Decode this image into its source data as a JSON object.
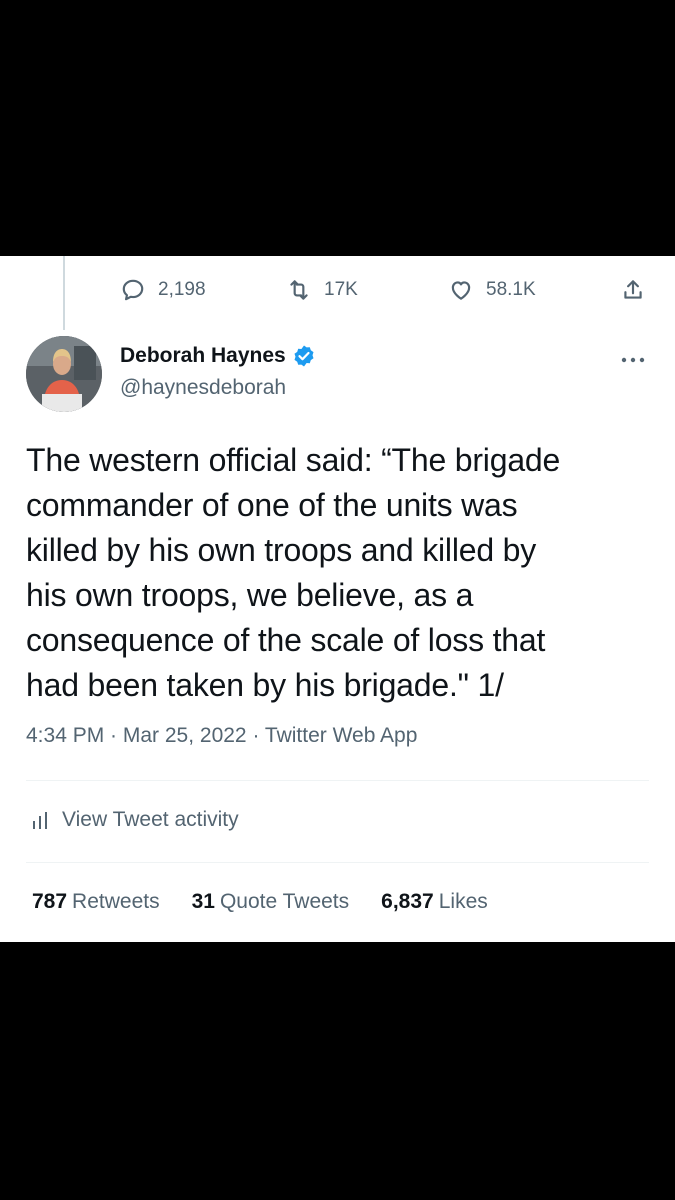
{
  "actions": {
    "reply_count": "2,198",
    "retweet_count": "17K",
    "like_count": "58.1K",
    "icons": [
      "reply-icon",
      "retweet-icon",
      "like-icon",
      "share-icon"
    ]
  },
  "author": {
    "name": "Deborah Haynes",
    "handle": "@haynesdeborah",
    "verified": true,
    "verified_color": "#1d9bf0"
  },
  "tweet": {
    "lines": [
      "The western official said: “The brigade",
      "commander of one of the units was",
      "killed by his own troops and killed by",
      "his own troops, we believe, as a",
      "consequence of the scale of loss that",
      "had been taken by his brigade.\" 1/"
    ],
    "meta": "4:34 PM · Mar 25, 2022 · Twitter Web App"
  },
  "activity": {
    "label": "View Tweet activity"
  },
  "stats": {
    "retweets_count": "787",
    "retweets_label": "Retweets",
    "quotes_count": "31",
    "quotes_label": "Quote Tweets",
    "likes_count": "6,837",
    "likes_label": "Likes"
  }
}
